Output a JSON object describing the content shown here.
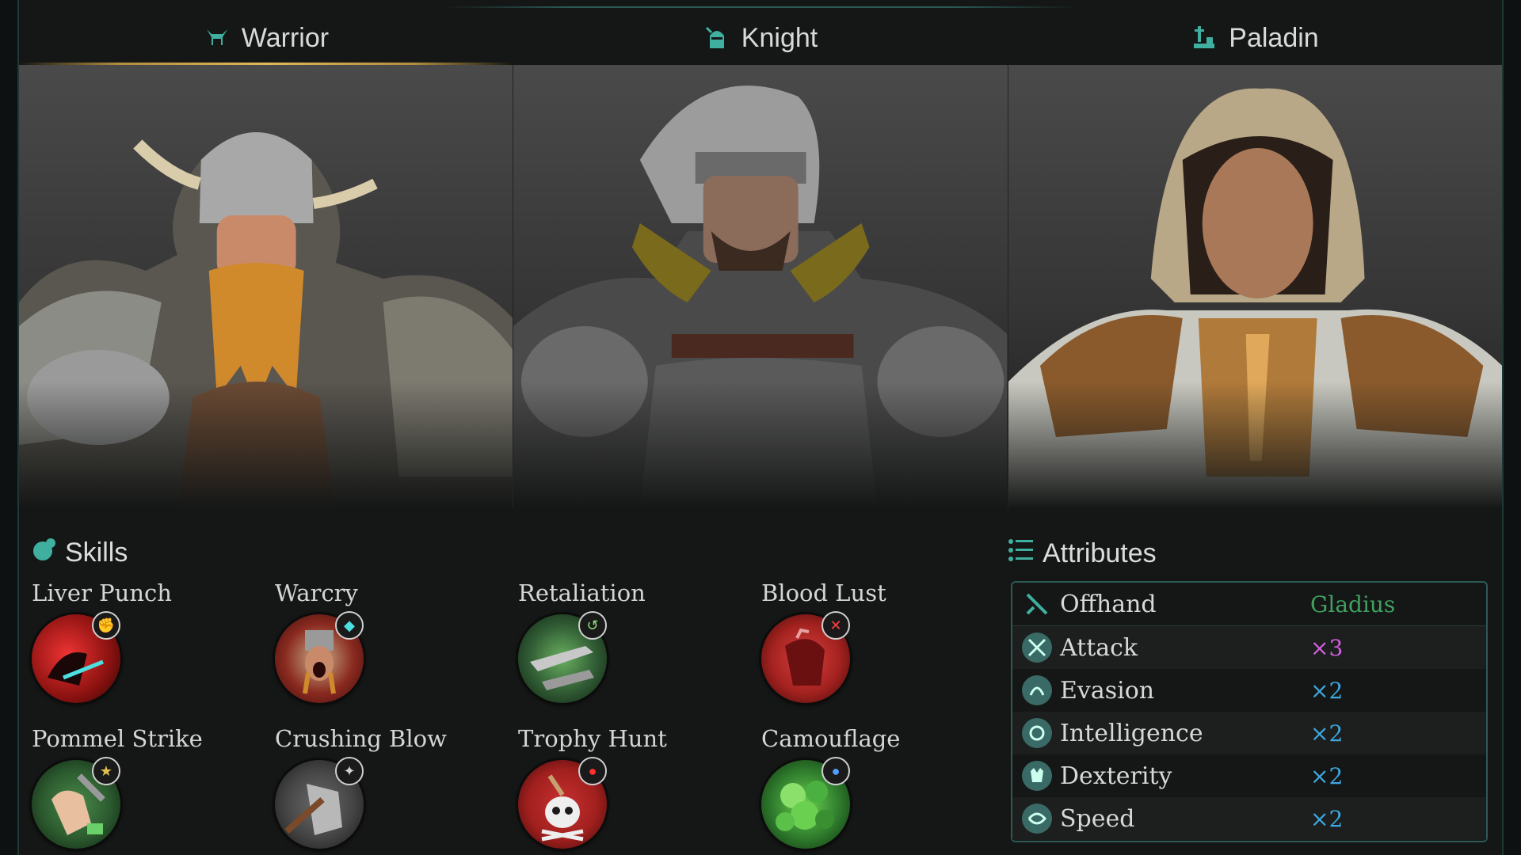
{
  "tabs": [
    {
      "label": "Warrior",
      "icon": "helmet-horned-icon",
      "active": true
    },
    {
      "label": "Knight",
      "icon": "knight-helmet-icon",
      "active": false
    },
    {
      "label": "Paladin",
      "icon": "sword-anvil-icon",
      "active": false
    }
  ],
  "skills": {
    "title": "Skills",
    "items": [
      {
        "name": "Liver Punch",
        "icon": "punch-icon",
        "badge": "strength-badge-icon",
        "color": "#b8201c"
      },
      {
        "name": "Warcry",
        "icon": "warcry-icon",
        "badge": "mind-badge-icon",
        "color": "#9b3a2a"
      },
      {
        "name": "Retaliation",
        "icon": "retaliation-icon",
        "badge": "reflect-badge-icon",
        "color": "#2f5a33"
      },
      {
        "name": "Blood Lust",
        "icon": "blood-lust-icon",
        "badge": "bleed-badge-icon",
        "color": "#a3221f"
      },
      {
        "name": "Pommel Strike",
        "icon": "fist-icon",
        "badge": "stun-badge-icon",
        "color": "#2b5a2e"
      },
      {
        "name": "Crushing Blow",
        "icon": "axe-icon",
        "badge": "crush-badge-icon",
        "color": "#444444"
      },
      {
        "name": "Trophy Hunt",
        "icon": "skull-icon",
        "badge": "blood-drop-badge-icon",
        "color": "#a1201e"
      },
      {
        "name": "Camouflage",
        "icon": "leaves-icon",
        "badge": "water-drop-badge-icon",
        "color": "#2e7a2c"
      }
    ]
  },
  "attributes": {
    "title": "Attributes",
    "rows": [
      {
        "label": "Offhand",
        "value": "Gladius",
        "icon": "offhand-icon",
        "value_color": "#3fa060"
      },
      {
        "label": "Attack",
        "value": "×3",
        "icon": "attack-icon",
        "value_color": "#d35fe0"
      },
      {
        "label": "Evasion",
        "value": "×2",
        "icon": "evasion-icon",
        "value_color": "#3fa7e0"
      },
      {
        "label": "Intelligence",
        "value": "×2",
        "icon": "intelligence-icon",
        "value_color": "#3fa7e0"
      },
      {
        "label": "Dexterity",
        "value": "×2",
        "icon": "dexterity-icon",
        "value_color": "#3fa7e0"
      },
      {
        "label": "Speed",
        "value": "×2",
        "icon": "speed-icon",
        "value_color": "#3fa7e0"
      }
    ]
  },
  "portraits": [
    {
      "name": "warrior-portrait",
      "accent": "#d08a2c"
    },
    {
      "name": "knight-portrait",
      "accent": "#7a6a1c"
    },
    {
      "name": "paladin-portrait",
      "accent": "#b07a3a"
    }
  ],
  "accent_colors": {
    "teal": "#3fb0a0",
    "gold": "#e0b85a"
  }
}
